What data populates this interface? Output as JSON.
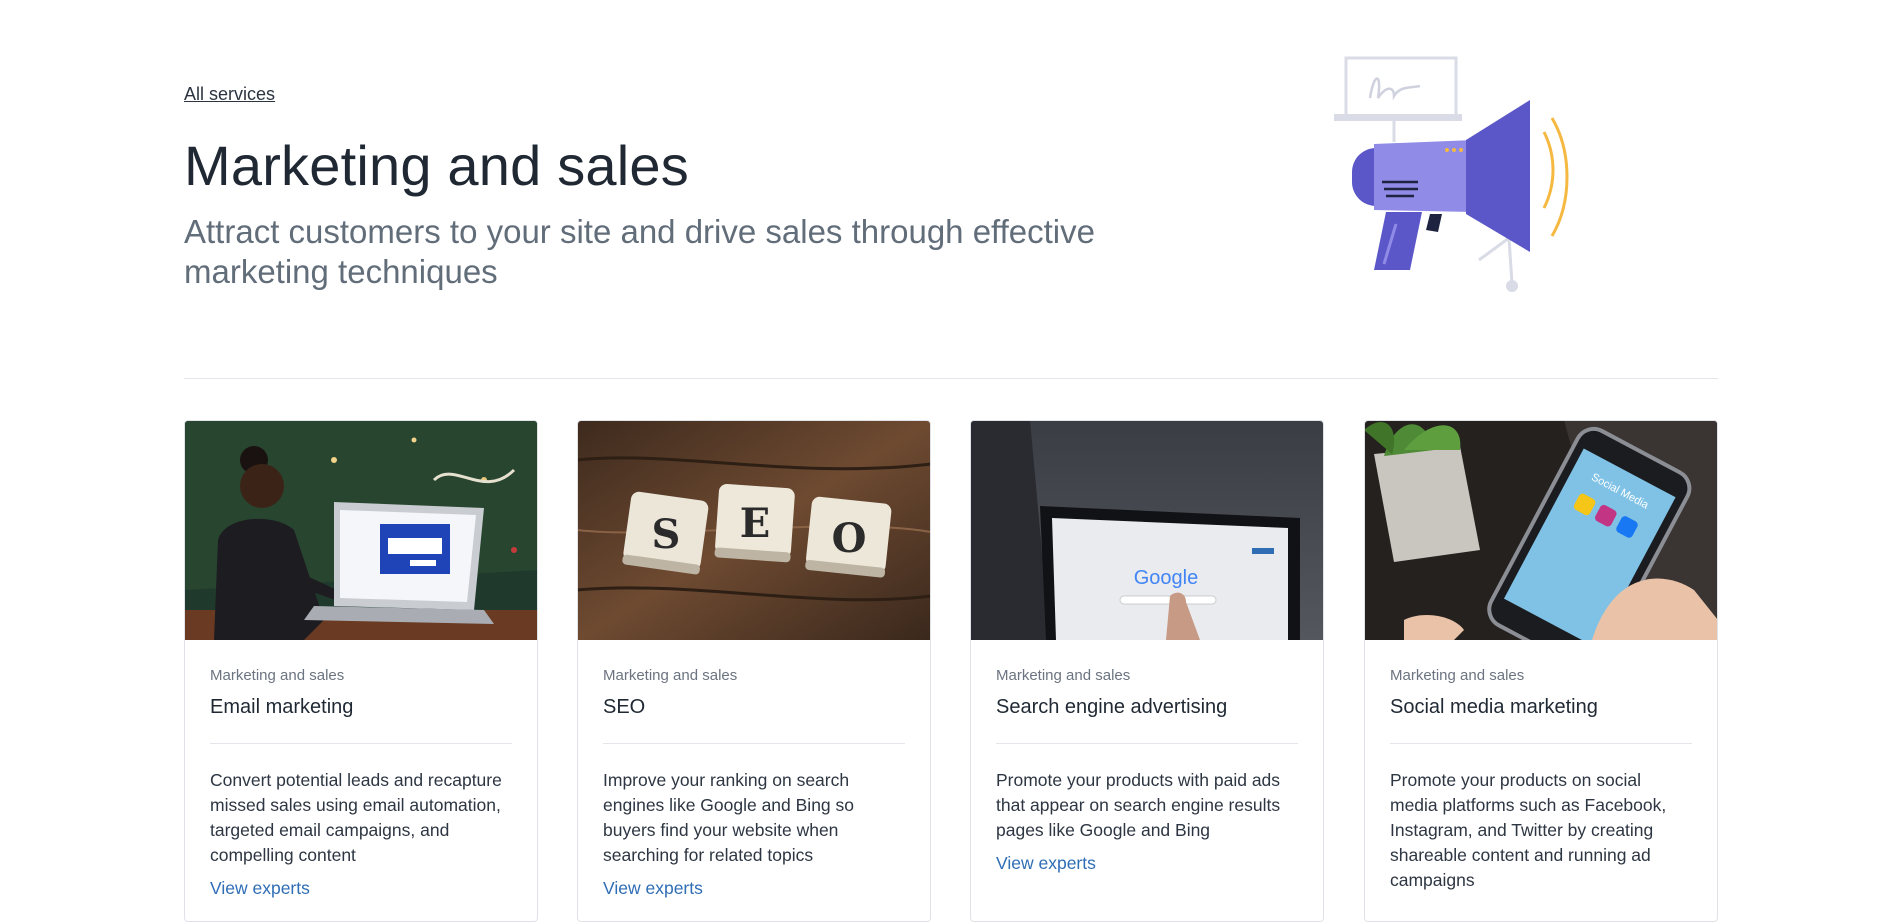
{
  "breadcrumb": {
    "label": "All services"
  },
  "header": {
    "title": "Marketing and sales",
    "subtitle": "Attract customers to your site and drive sales through effective marketing techniques"
  },
  "colors": {
    "accent_purple": "#5b57c9",
    "light_purple": "#8f8be6",
    "link_blue": "#2f6db5",
    "sound_yellow": "#f5b942"
  },
  "cards": [
    {
      "image": "girl-using-laptop-photo",
      "category": "Marketing and sales",
      "title": "Email marketing",
      "description": "Convert potential leads and recapture missed sales using email automation, targeted email campaigns, and compelling content",
      "link": "View experts"
    },
    {
      "image": "seo-scrabble-tiles-photo",
      "category": "Marketing and sales",
      "title": "SEO",
      "description": "Improve your ranking on search engines like Google and Bing so buyers find your website when searching for related topics",
      "link": "View experts"
    },
    {
      "image": "google-on-tablet-photo",
      "category": "Marketing and sales",
      "title": "Search engine advertising",
      "description": "Promote your products with paid ads that appear on search engine results pages like Google and Bing",
      "link": "View experts"
    },
    {
      "image": "social-media-phone-photo",
      "category": "Marketing and sales",
      "title": "Social media marketing",
      "description": "Promote your products on social media platforms such as Facebook, Instagram, and Twitter by creating shareable content and running ad campaigns",
      "link": "View experts"
    }
  ],
  "images": {
    "seo_letters": [
      "S",
      "E",
      "O"
    ],
    "google_logo": "Google",
    "phone_screen_label": "Social Media"
  }
}
